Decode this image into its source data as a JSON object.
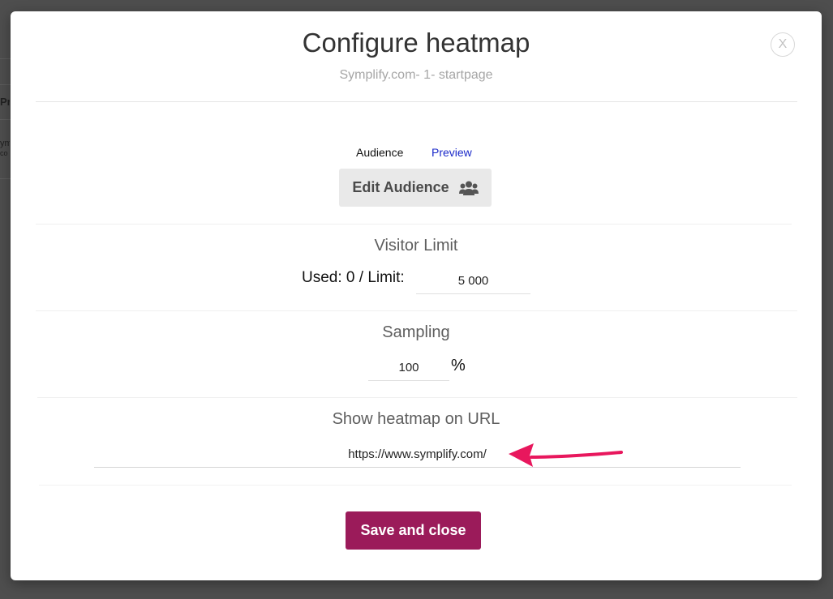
{
  "background": {
    "fragments": [
      "Pro",
      "ym",
      "co"
    ]
  },
  "modal": {
    "title": "Configure heatmap",
    "subtitle": "Symplify.com- 1- startpage",
    "close_label": "X"
  },
  "tabs": {
    "audience_label": "Audience",
    "preview_label": "Preview"
  },
  "audience": {
    "edit_button_label": "Edit Audience",
    "icon": "users-icon"
  },
  "visitor_limit": {
    "title": "Visitor Limit",
    "used_label": "Used: 0 / Limit:",
    "limit_value": "5 000"
  },
  "sampling": {
    "title": "Sampling",
    "value": "100",
    "unit": "%"
  },
  "url_section": {
    "title": "Show heatmap on URL",
    "url_value": "https://www.symplify.com/"
  },
  "save_button_label": "Save and close",
  "colors": {
    "primary_button": "#9b1b5a",
    "link": "#1a29c9",
    "annotation_arrow": "#e8175d"
  }
}
